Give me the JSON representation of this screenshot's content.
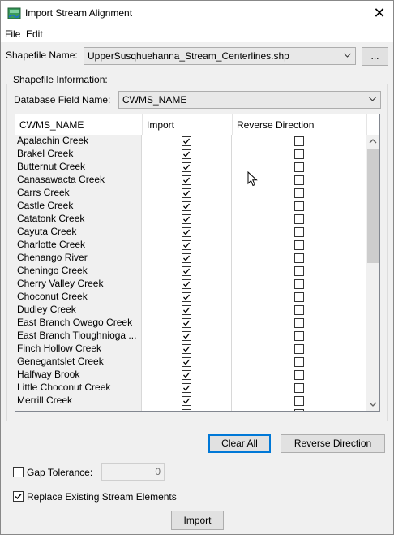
{
  "window": {
    "title": "Import Stream Alignment"
  },
  "menu": [
    "File",
    "Edit"
  ],
  "shapefile": {
    "label": "Shapefile Name:",
    "value": "UpperSusqhuehanna_Stream_Centerlines.shp",
    "browse_label": "..."
  },
  "info_group": {
    "legend": "Shapefile Information:",
    "field_label": "Database Field Name:",
    "field_value": "CWMS_NAME"
  },
  "table": {
    "columns": [
      "CWMS_NAME",
      "Import",
      "Reverse Direction"
    ],
    "rows": [
      {
        "name": "Apalachin Creek",
        "import": true,
        "reverse": false
      },
      {
        "name": "Brakel Creek",
        "import": true,
        "reverse": false
      },
      {
        "name": "Butternut Creek",
        "import": true,
        "reverse": false
      },
      {
        "name": "Canasawacta Creek",
        "import": true,
        "reverse": false
      },
      {
        "name": "Carrs Creek",
        "import": true,
        "reverse": false
      },
      {
        "name": "Castle Creek",
        "import": true,
        "reverse": false
      },
      {
        "name": "Catatonk Creek",
        "import": true,
        "reverse": false
      },
      {
        "name": "Cayuta Creek",
        "import": true,
        "reverse": false
      },
      {
        "name": "Charlotte Creek",
        "import": true,
        "reverse": false
      },
      {
        "name": "Chenango River",
        "import": true,
        "reverse": false
      },
      {
        "name": "Cheningo Creek",
        "import": true,
        "reverse": false
      },
      {
        "name": "Cherry Valley Creek",
        "import": true,
        "reverse": false
      },
      {
        "name": "Choconut Creek",
        "import": true,
        "reverse": false
      },
      {
        "name": "Dudley Creek",
        "import": true,
        "reverse": false
      },
      {
        "name": "East Branch Owego Creek",
        "import": true,
        "reverse": false
      },
      {
        "name": "East Branch Tioughnioga ...",
        "import": true,
        "reverse": false
      },
      {
        "name": "Finch Hollow Creek",
        "import": true,
        "reverse": false
      },
      {
        "name": "Genegantslet Creek",
        "import": true,
        "reverse": false
      },
      {
        "name": "Halfway Brook",
        "import": true,
        "reverse": false
      },
      {
        "name": "Little Choconut Creek",
        "import": true,
        "reverse": false
      },
      {
        "name": "Merrill Creek",
        "import": true,
        "reverse": false
      },
      {
        "name": "",
        "import": true,
        "reverse": false
      }
    ]
  },
  "actions": {
    "clear_all": "Clear All",
    "reverse_direction": "Reverse Direction"
  },
  "options": {
    "gap_tolerance_label": "Gap Tolerance:",
    "gap_tolerance_value": "0",
    "gap_tolerance_checked": false,
    "replace_label": "Replace Existing Stream Elements",
    "replace_checked": true
  },
  "import_button": "Import",
  "colors": {
    "focus": "#0078d7",
    "app_icon": "#2e8b57"
  }
}
